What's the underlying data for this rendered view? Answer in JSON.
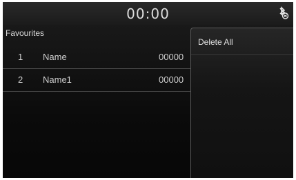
{
  "status_bar": {
    "clock": "00:00",
    "bluetooth_icon": "bluetooth-phone-icon"
  },
  "favourites": {
    "title": "Favourites",
    "items": [
      {
        "index": "1",
        "name": "Name",
        "number": "00000"
      },
      {
        "index": "2",
        "name": "Name1",
        "number": "00000"
      }
    ]
  },
  "menu": {
    "items": [
      {
        "label": "Delete All"
      }
    ]
  },
  "colors": {
    "background": "#0f0f0f",
    "text": "#cfcfcf",
    "divider": "#4a4a4a"
  }
}
